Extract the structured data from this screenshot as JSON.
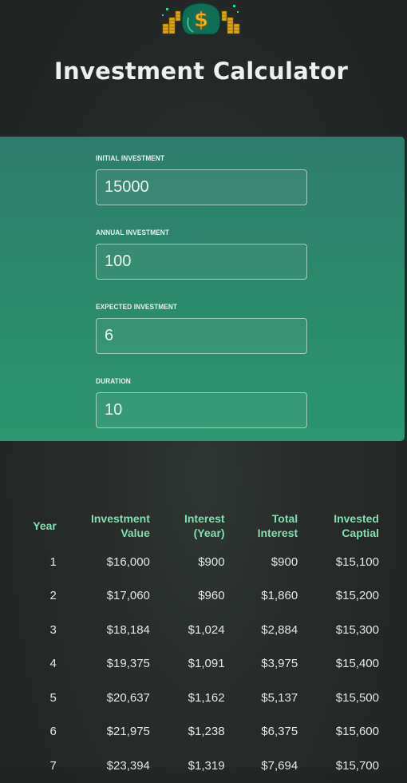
{
  "header": {
    "logo_icon": "money-bag-icon",
    "title": "Investment Calculator"
  },
  "inputs": [
    {
      "label": "INITIAL INVESTMENT",
      "value": "15000"
    },
    {
      "label": "ANNUAL INVESTMENT",
      "value": "100"
    },
    {
      "label": "EXPECTED INVESTMENT",
      "value": "6"
    },
    {
      "label": "DURATION",
      "value": "10"
    }
  ],
  "table": {
    "headers": [
      "Year",
      "Investment Value",
      "Interest (Year)",
      "Total Interest",
      "Invested Captial"
    ],
    "rows": [
      [
        "1",
        "$16,000",
        "$900",
        "$900",
        "$15,100"
      ],
      [
        "2",
        "$17,060",
        "$960",
        "$1,860",
        "$15,200"
      ],
      [
        "3",
        "$18,184",
        "$1,024",
        "$2,884",
        "$15,300"
      ],
      [
        "4",
        "$19,375",
        "$1,091",
        "$3,975",
        "$15,400"
      ],
      [
        "5",
        "$20,637",
        "$1,162",
        "$5,137",
        "$15,500"
      ],
      [
        "6",
        "$21,975",
        "$1,238",
        "$6,375",
        "$15,600"
      ],
      [
        "7",
        "$23,394",
        "$1,319",
        "$7,694",
        "$15,700"
      ]
    ]
  },
  "colors": {
    "background": "#262a29",
    "card_top": "#2f7c6c",
    "card_bottom": "#2b9670",
    "header_text": "#7fe0b0"
  }
}
